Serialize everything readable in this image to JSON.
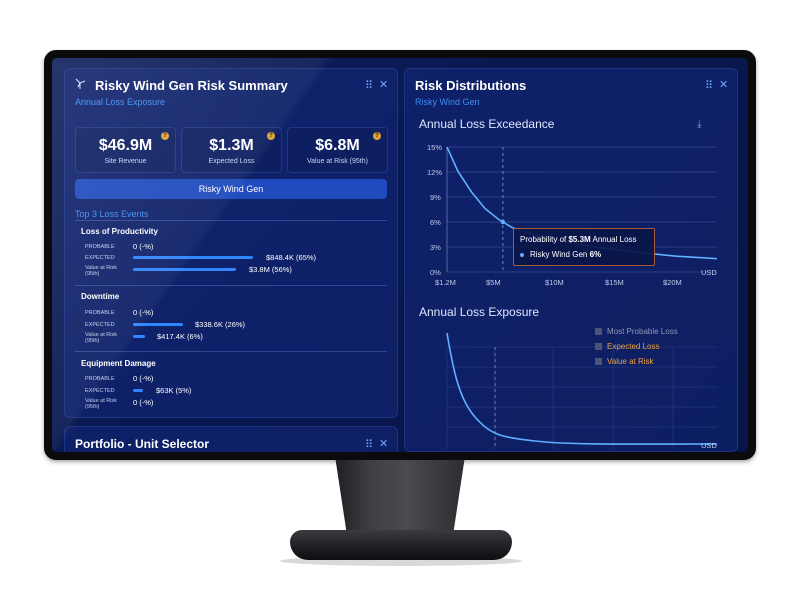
{
  "summary_panel": {
    "title": "Risky Wind Gen Risk Summary",
    "subtitle": "Annual Loss Exposure",
    "controls": {
      "drag": "⠿",
      "close": "✕"
    },
    "kpis": [
      {
        "value": "$46.9M",
        "label": "Site Revenue"
      },
      {
        "value": "$1.3M",
        "label": "Expected Loss"
      },
      {
        "value": "$6.8M",
        "label": "Value at Risk (95th)"
      }
    ],
    "unit_name": "Risky Wind Gen",
    "top_events_heading": "Top 3 Loss Events",
    "events": [
      {
        "title": "Loss of Productivity",
        "probable_label": "PROBABLE",
        "probable": "0 (-%)",
        "expected_label": "EXPECTED",
        "expected": "$848.4K (65%)",
        "expected_frac": 0.65,
        "var_label": "Value at Risk (95th)",
        "var": "$3.8M (56%)",
        "var_frac": 0.56
      },
      {
        "title": "Downtime",
        "probable_label": "PROBABLE",
        "probable": "0 (-%)",
        "expected_label": "EXPECTED",
        "expected": "$338.6K (26%)",
        "expected_frac": 0.26,
        "var_label": "Value at Risk (95th)",
        "var": "$417.4K (6%)",
        "var_frac": 0.06
      },
      {
        "title": "Equipment Damage",
        "probable_label": "PROBABLE",
        "probable": "0 (-%)",
        "expected_label": "EXPECTED",
        "expected": "$63K (5%)",
        "expected_frac": 0.05,
        "var_label": "Value at Risk (95th)",
        "var": "0 (-%)",
        "var_frac": 0
      }
    ]
  },
  "portfolio_panel": {
    "title": "Portfolio - Unit Selector",
    "controls": {
      "drag": "⠿",
      "close": "✕"
    }
  },
  "distributions_panel": {
    "title": "Risk Distributions",
    "subtitle": "Risky Wind Gen",
    "controls": {
      "drag": "⠿",
      "close": "✕"
    },
    "download_icon": "⤓",
    "exceedance": {
      "title": "Annual Loss Exceedance",
      "y_ticks": [
        "15%",
        "12%",
        "9%",
        "6%",
        "3%",
        "0%"
      ],
      "x_ticks": [
        "$1.2M",
        "$5M",
        "$10M",
        "$15M",
        "$20M"
      ],
      "x_unit": "USD",
      "tooltip": {
        "prefix": "Probability of ",
        "amount": "$5.3M",
        "suffix": " Annual Loss",
        "series": "Risky Wind Gen",
        "value": "6%"
      }
    },
    "exposure": {
      "title": "Annual Loss Exposure",
      "x_unit": "USD",
      "legend": [
        {
          "label": "Most Probable Loss",
          "color": "#8f98b8"
        },
        {
          "label": "Expected Loss",
          "color": "#f0a23a"
        },
        {
          "label": "Value at Risk",
          "color": "#f0a23a"
        }
      ]
    }
  },
  "chart_data": [
    {
      "type": "line",
      "title": "Annual Loss Exceedance",
      "xlabel": "USD",
      "ylabel": "",
      "x": [
        1.2,
        2,
        3,
        4,
        5,
        5.3,
        6,
        8,
        10,
        12,
        15,
        18,
        20,
        21
      ],
      "series": [
        {
          "name": "Risky Wind Gen",
          "values": [
            15,
            12.1,
            9.6,
            7.6,
            6.3,
            6,
            5.3,
            4.3,
            3.6,
            3.0,
            2.4,
            1.9,
            1.7,
            1.6
          ]
        }
      ],
      "x_ticks": [
        "$1.2M",
        "$5M",
        "$10M",
        "$15M",
        "$20M"
      ],
      "xlim": [
        1.2,
        21
      ],
      "ylim": [
        0,
        15
      ],
      "grid": true
    }
  ]
}
